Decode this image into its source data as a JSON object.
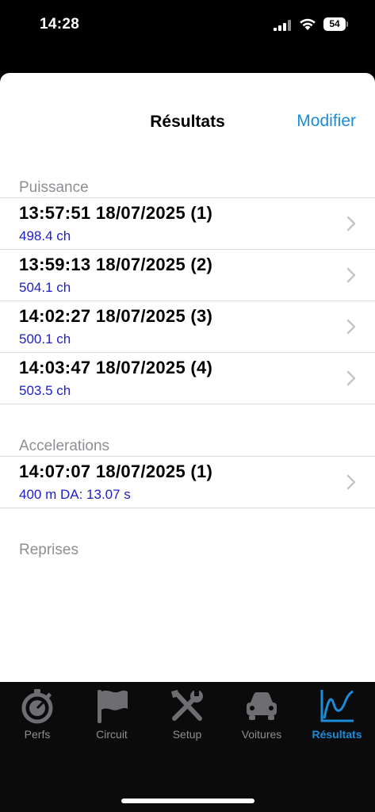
{
  "status_bar": {
    "time": "14:28",
    "battery": "54"
  },
  "nav": {
    "title": "Résultats",
    "edit_label": "Modifier"
  },
  "sections": [
    {
      "header": "Puissance",
      "rows": [
        {
          "title": "13:57:51 18/07/2025 (1)",
          "subtitle": "498.4 ch"
        },
        {
          "title": "13:59:13 18/07/2025 (2)",
          "subtitle": "504.1 ch"
        },
        {
          "title": "14:02:27 18/07/2025 (3)",
          "subtitle": "500.1 ch"
        },
        {
          "title": "14:03:47 18/07/2025 (4)",
          "subtitle": "503.5 ch"
        }
      ]
    },
    {
      "header": "Accelerations",
      "rows": [
        {
          "title": "14:07:07 18/07/2025 (1)",
          "subtitle": "400 m DA: 13.07 s"
        }
      ]
    },
    {
      "header": "Reprises",
      "rows": []
    }
  ],
  "tabbar": {
    "tabs": [
      {
        "label": "Perfs",
        "icon": "stopwatch-icon"
      },
      {
        "label": "Circuit",
        "icon": "flag-icon"
      },
      {
        "label": "Setup",
        "icon": "tools-icon"
      },
      {
        "label": "Voitures",
        "icon": "car-icon"
      },
      {
        "label": "Résultats",
        "icon": "chart-icon",
        "active": true
      }
    ]
  },
  "colors": {
    "accent": "#1a8cd8",
    "subtitle": "#2020c8",
    "section_header": "#8e8e93"
  }
}
